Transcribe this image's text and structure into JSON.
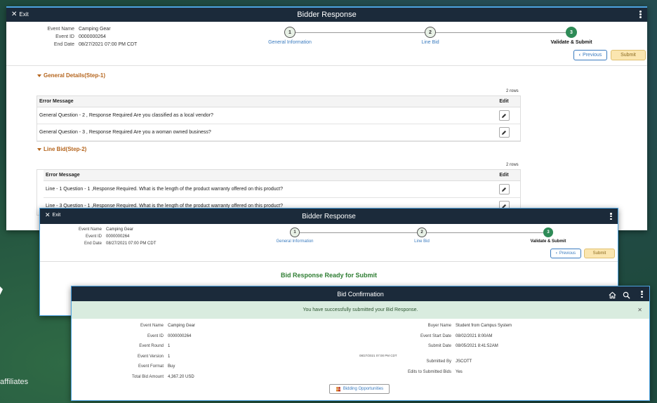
{
  "background": {
    "affiliates_text": "affiliates"
  },
  "w1": {
    "title": "Bidder Response",
    "exit_label": "Exit",
    "meta": [
      {
        "label": "Event Name",
        "value": "Camping Gear"
      },
      {
        "label": "Event ID",
        "value": "0000000264"
      },
      {
        "label": "End Date",
        "value": "08/27/2021 07:00 PM CDT"
      }
    ],
    "steps": [
      {
        "number": "1",
        "label": "General Information"
      },
      {
        "number": "2",
        "label": "Line Bid"
      },
      {
        "number": "3",
        "label": "Validate & Submit"
      }
    ],
    "previous_label": "Previous",
    "submit_label": "Submit",
    "general_details": {
      "title": "General Details(Step-1)",
      "rows_count": "2 rows",
      "col_error": "Error Message",
      "col_edit": "Edit",
      "rows": [
        "General Question -  2 , Response Required Are you classified as a local vendor?",
        "General Question -  3 , Response Required Are you a woman owned business?"
      ]
    },
    "line_bid": {
      "title": "Line Bid(Step-2)",
      "rows_count": "2 rows",
      "col_error": "Error Message",
      "col_edit": "Edit",
      "rows": [
        "Line - 1 Question - 1 ,Response Required. What is the length of the product warranty offered on this product?",
        "Line - 3 Question - 1 ,Response Required. What is the length of the product warranty offered on this product?"
      ]
    }
  },
  "w2": {
    "title": "Bidder Response",
    "exit_label": "Exit",
    "meta": [
      {
        "label": "Event Name",
        "value": "Camping Gear"
      },
      {
        "label": "Event ID",
        "value": "0000000264"
      },
      {
        "label": "End Date",
        "value": "08/27/2021 07:00 PM CDT"
      }
    ],
    "steps": [
      {
        "number": "1",
        "label": "General Information"
      },
      {
        "number": "2",
        "label": "Line Bid"
      },
      {
        "number": "3",
        "label": "Validate & Submit"
      }
    ],
    "previous_label": "Previous",
    "submit_label": "Submit",
    "ready_text": "Bid Response Ready for Submit"
  },
  "w3": {
    "title": "Bid Confirmation",
    "success_message": "You have successfully submitted your Bid Response.",
    "left_fields": [
      {
        "label": "Event Name",
        "value": "Camping Gear"
      },
      {
        "label": "Event ID",
        "value": "0000000264"
      },
      {
        "label": "Event Round",
        "value": "1"
      },
      {
        "label": "Event Version",
        "value": "1"
      },
      {
        "label": "Event Format",
        "value": "Buy"
      },
      {
        "label": "Total Bid Amount",
        "value": "4,367.20 USD"
      }
    ],
    "middle_date": "08/27/2021 07:00 PM CDT",
    "right_fields_top": [
      {
        "label": "Buyer Name",
        "value": "Student from Campus System"
      },
      {
        "label": "Event Start Date",
        "value": "08/02/2021  8:00AM"
      },
      {
        "label": "Submit Date",
        "value": "08/05/2021  8:41:52AM"
      }
    ],
    "right_fields_bottom": [
      {
        "label": "Submitted By",
        "value": "JSCOTT"
      },
      {
        "label": "Edits to Submitted Bids",
        "value": "Yes"
      }
    ],
    "opportunities_label": "Bidding Opportunities"
  }
}
